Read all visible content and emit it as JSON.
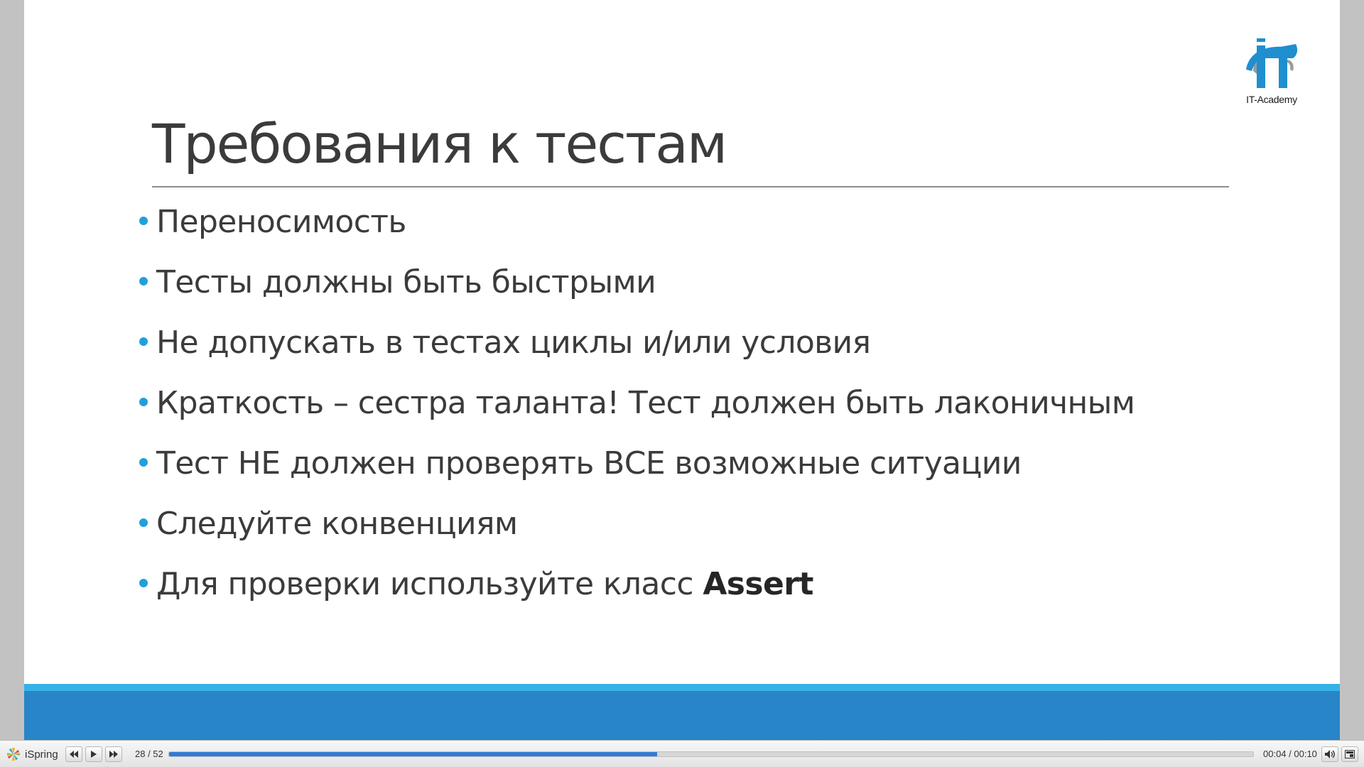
{
  "slide": {
    "title": "Требования к тестам",
    "logo": {
      "caption": "IT-Academy",
      "icon": "it-academy-logo-icon",
      "colors": {
        "blue": "#1f8fcf",
        "gray": "#9a9a9a"
      }
    },
    "bullets": [
      {
        "text": "Переносимость",
        "strong": ""
      },
      {
        "text": "Тесты должны быть быстрыми",
        "strong": ""
      },
      {
        "text": "Не допускать в тестах циклы и/или условия",
        "strong": ""
      },
      {
        "text": "Краткость – сестра таланта! Тест должен быть лаконичным",
        "strong": ""
      },
      {
        "text": "Тест НЕ должен проверять ВСЕ возможные ситуации",
        "strong": ""
      },
      {
        "text": "Следуйте конвенциям",
        "strong": ""
      },
      {
        "text": "Для проверки используйте класс ",
        "strong": "Assert"
      }
    ],
    "colors": {
      "bullet": "#20a0da",
      "text": "#3b3b3b",
      "band_light": "#35b2e6",
      "band_dark": "#2885c7"
    }
  },
  "player": {
    "brand": "iSpring",
    "brand_icon": "ispring-pinwheel-icon",
    "buttons": [
      {
        "name": "previous-slide-button",
        "icon": "rewind-icon"
      },
      {
        "name": "play-button",
        "icon": "play-icon"
      },
      {
        "name": "next-slide-button",
        "icon": "fast-forward-icon"
      }
    ],
    "slide_counter": "28 / 52",
    "progress_fraction": 0.45,
    "progress_color": "#2f7bd8",
    "time": "00:04 / 00:10",
    "volume_icon": "volume-icon",
    "fullscreen_icon": "fullscreen-icon"
  }
}
